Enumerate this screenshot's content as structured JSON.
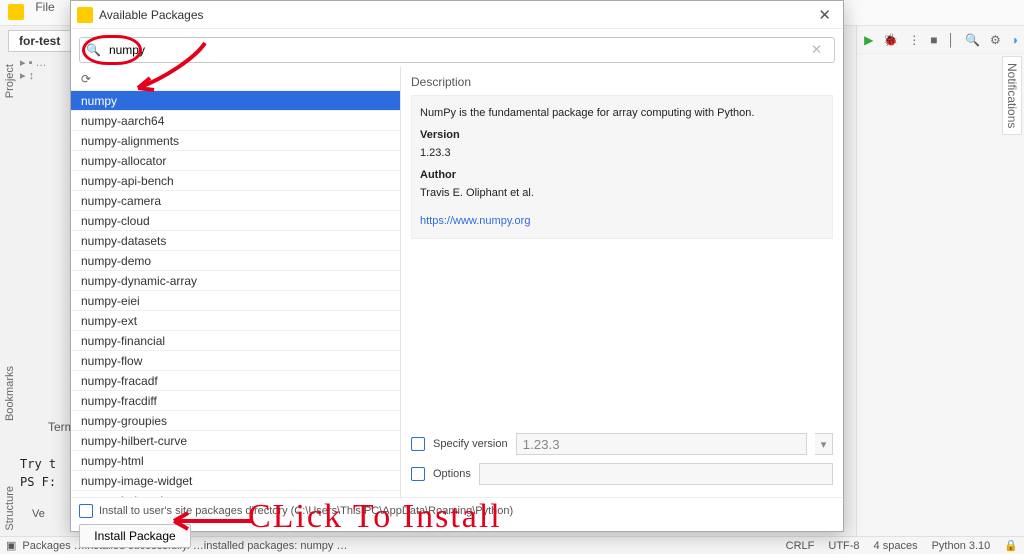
{
  "bg": {
    "file_menu_label": "File",
    "project_tab": "for-test",
    "left_project": "Project",
    "left_bookmarks": "Bookmarks",
    "left_structure": "Structure",
    "right_notifications": "Notifications",
    "terminal_tab": "Termin",
    "term_line1": "Try t",
    "term_line2": "PS F:",
    "version_tab": "Ve"
  },
  "statusbar": {
    "msg": "Packages …installed successfully. …installed packages: numpy …",
    "crlf": "CRLF",
    "encoding": "UTF-8",
    "indent": "4 spaces",
    "interpreter": "Python 3.10"
  },
  "modal": {
    "title": "Available Packages",
    "search_value": "numpy",
    "packages": [
      "numpy",
      "numpy-aarch64",
      "numpy-alignments",
      "numpy-allocator",
      "numpy-api-bench",
      "numpy-camera",
      "numpy-cloud",
      "numpy-datasets",
      "numpy-demo",
      "numpy-dynamic-array",
      "numpy-eiei",
      "numpy-ext",
      "numpy-financial",
      "numpy-flow",
      "numpy-fracadf",
      "numpy-fracdiff",
      "numpy-groupies",
      "numpy-hilbert-curve",
      "numpy-html",
      "numpy-image-widget",
      "numpy-indexed"
    ],
    "selected_index": 0,
    "desc_header": "Description",
    "desc_text": "NumPy is the fundamental package for array computing with Python.",
    "version_label": "Version",
    "version_value": "1.23.3",
    "author_label": "Author",
    "author_value": "Travis E. Oliphant et al.",
    "homepage": "https://www.numpy.org",
    "specify_version_label": "Specify version",
    "specify_version_value": "1.23.3",
    "options_label": "Options",
    "install_dir_label": "Install to user's site packages directory (C:\\Users\\This PC\\AppData\\Roaming\\Python)",
    "install_button": "Install Package"
  },
  "annotations": {
    "click_to_install": "CLick To Install"
  }
}
